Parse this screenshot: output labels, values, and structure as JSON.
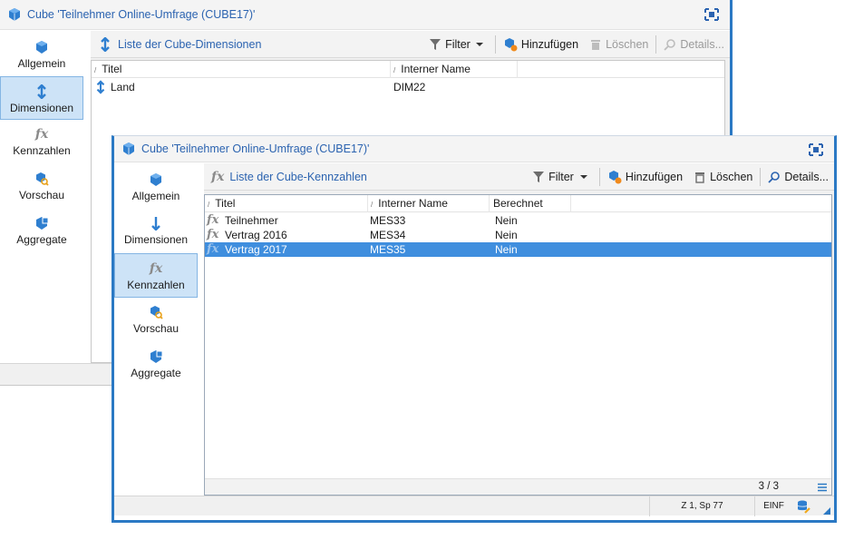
{
  "back": {
    "title": "Cube 'Teilnehmer Online-Umfrage (CUBE17)'",
    "sidebar": [
      {
        "label": "Allgemein",
        "icon": "cube-icon"
      },
      {
        "label": "Dimensionen",
        "icon": "dimension-arrow-icon",
        "active": true
      },
      {
        "label": "Kennzahlen",
        "icon": "fx-icon"
      },
      {
        "label": "Vorschau",
        "icon": "preview-icon"
      },
      {
        "label": "Aggregate",
        "icon": "aggregate-icon"
      }
    ],
    "toolbar": {
      "title": "Liste der Cube-Dimensionen",
      "filter": "Filter",
      "add": "Hinzufügen",
      "delete": "Löschen",
      "details": "Details..."
    },
    "columns": [
      "Titel",
      "Interner Name"
    ],
    "rows": [
      {
        "title": "Land",
        "internal": "DIM22"
      }
    ]
  },
  "front": {
    "title": "Cube 'Teilnehmer Online-Umfrage (CUBE17)'",
    "sidebar": [
      {
        "label": "Allgemein",
        "icon": "cube-icon"
      },
      {
        "label": "Dimensionen",
        "icon": "dimension-arrow-icon"
      },
      {
        "label": "Kennzahlen",
        "icon": "fx-icon",
        "active": true
      },
      {
        "label": "Vorschau",
        "icon": "preview-icon"
      },
      {
        "label": "Aggregate",
        "icon": "aggregate-icon"
      }
    ],
    "fx": "fx",
    "toolbar": {
      "title": "Liste der Cube-Kennzahlen",
      "filter": "Filter",
      "add": "Hinzufügen",
      "delete": "Löschen",
      "details": "Details..."
    },
    "columns": [
      "Titel",
      "Interner Name",
      "Berechnet"
    ],
    "rows": [
      {
        "title": "Teilnehmer",
        "internal": "MES33",
        "calculated": "Nein"
      },
      {
        "title": "Vertrag 2016",
        "internal": "MES34",
        "calculated": "Nein"
      },
      {
        "title": "Vertrag 2017",
        "internal": "MES35",
        "calculated": "Nein",
        "selected": true
      }
    ],
    "count": "3 / 3",
    "status": {
      "position": "Z 1, Sp 77",
      "mode": "EINF"
    }
  },
  "colors": {
    "accent": "#2b79c4",
    "title_text": "#2b63b0",
    "selection": "#3f8ede",
    "sidebar_active": "#cde3f7"
  }
}
